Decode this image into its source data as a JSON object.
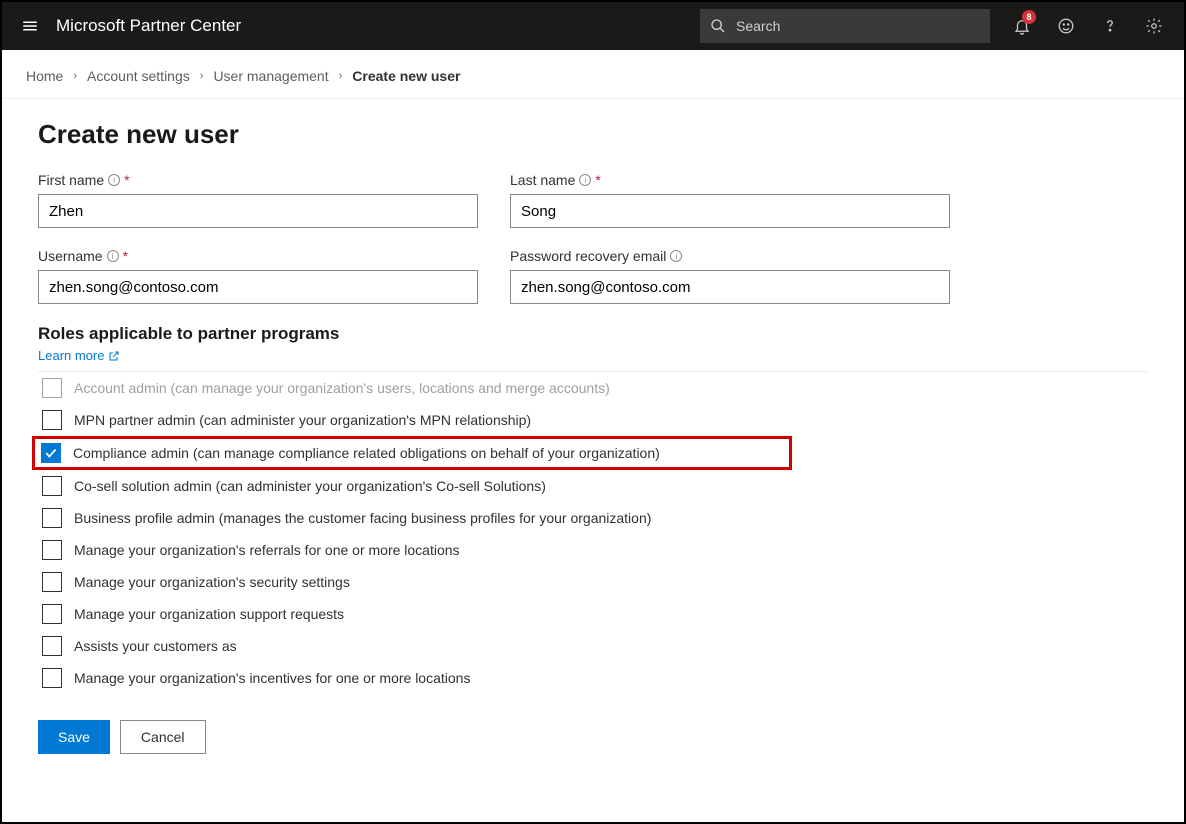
{
  "header": {
    "app_title": "Microsoft Partner Center",
    "search_placeholder": "Search",
    "notification_count": "8"
  },
  "breadcrumb": {
    "items": [
      {
        "label": "Home"
      },
      {
        "label": "Account settings"
      },
      {
        "label": "User management"
      },
      {
        "label": "Create new user"
      }
    ]
  },
  "page": {
    "title": "Create new user"
  },
  "form": {
    "first_name": {
      "label": "First name",
      "value": "Zhen",
      "required": true
    },
    "last_name": {
      "label": "Last name",
      "value": "Song",
      "required": true
    },
    "username": {
      "label": "Username",
      "value": "zhen.song@contoso.com",
      "required": true
    },
    "recovery_email": {
      "label": "Password recovery email",
      "value": "zhen.song@contoso.com",
      "required": false
    }
  },
  "roles": {
    "section_title": "Roles applicable to partner programs",
    "learn_more": "Learn more",
    "items": [
      {
        "label": "Account admin (can manage your organization's users, locations and merge accounts)",
        "checked": false,
        "truncated": true
      },
      {
        "label": "MPN partner admin (can administer your organization's MPN relationship)",
        "checked": false
      },
      {
        "label": "Compliance admin (can manage compliance related obligations on behalf of your organization)",
        "checked": true,
        "highlight": true
      },
      {
        "label": "Co-sell solution admin (can administer your organization's Co-sell Solutions)",
        "checked": false
      },
      {
        "label": "Business profile admin (manages the customer facing business profiles for your organization)",
        "checked": false
      },
      {
        "label": "Manage your organization's referrals for one or more locations",
        "checked": false
      },
      {
        "label": "Manage your organization's security settings",
        "checked": false
      },
      {
        "label": "Manage your organization support requests",
        "checked": false
      },
      {
        "label": "Assists your customers as",
        "checked": false
      },
      {
        "label": "Manage your organization's incentives for one or more locations",
        "checked": false
      }
    ]
  },
  "buttons": {
    "save": "Save",
    "cancel": "Cancel"
  }
}
